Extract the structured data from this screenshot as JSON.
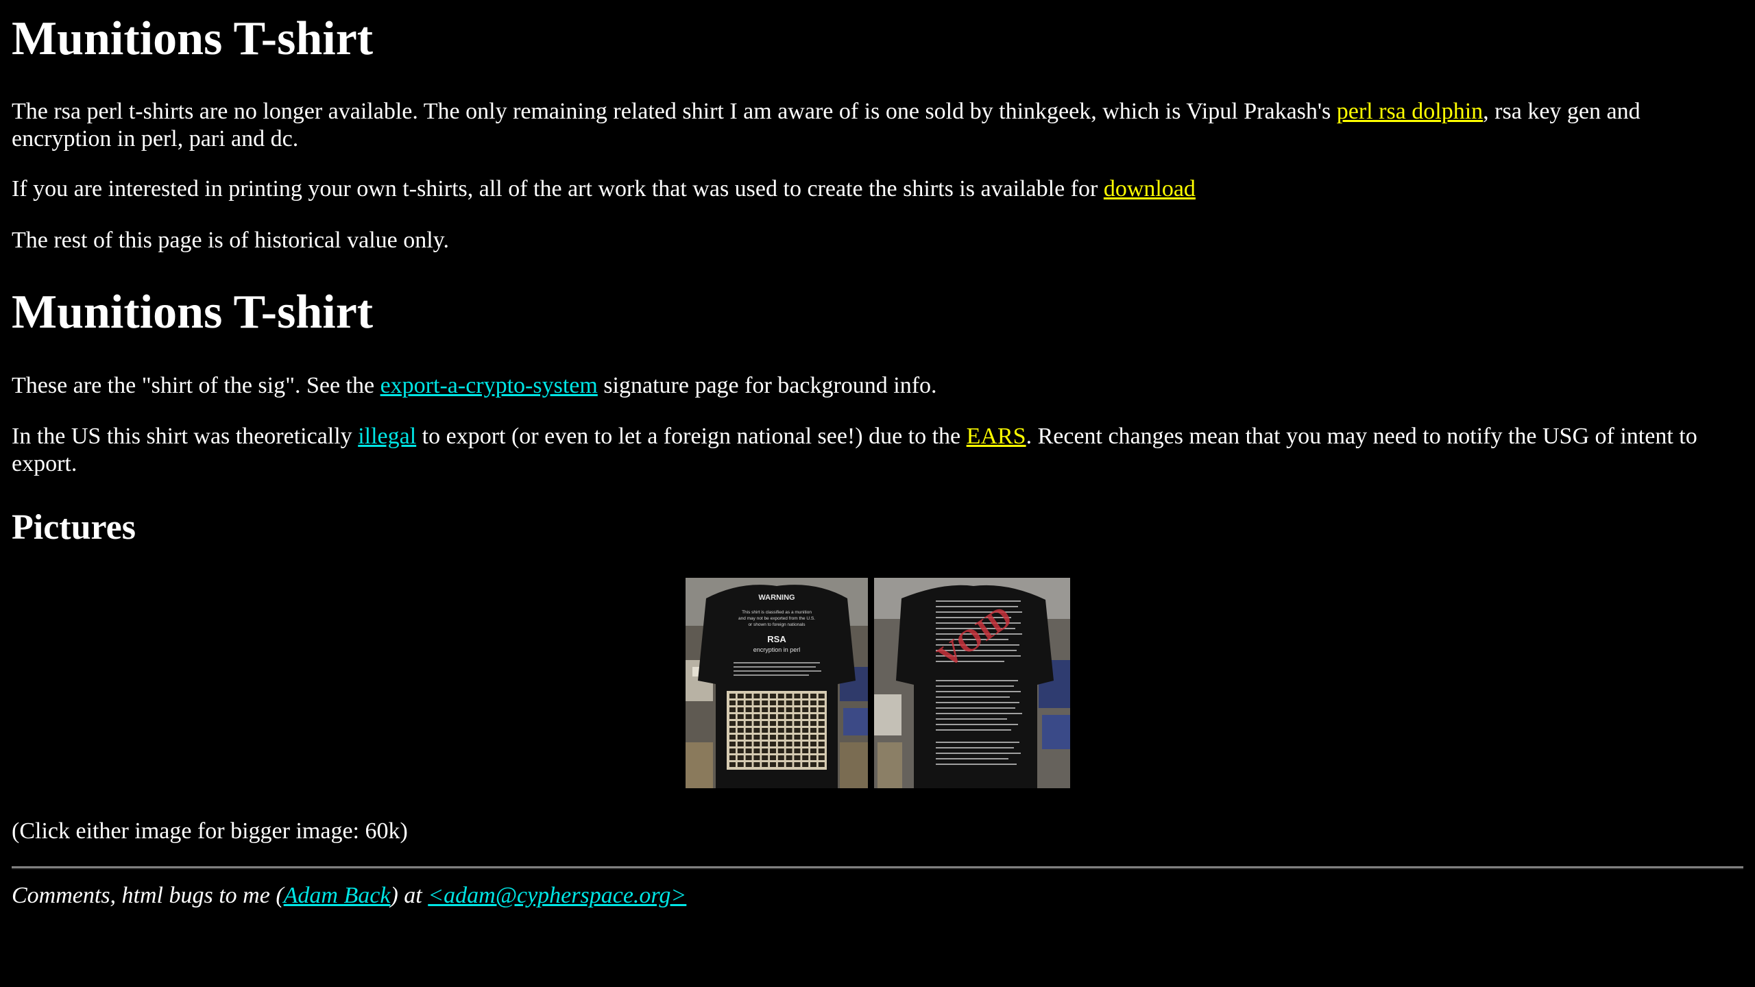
{
  "colors": {
    "background": "#000000",
    "text": "#ffffff",
    "link_visited": "#ffff00",
    "link": "#00e5e5"
  },
  "section1": {
    "title": "Munitions T-shirt",
    "p1_before": "The rsa perl t-shirts are no longer available. The only remaining related shirt I am aware of is one sold by thinkgeek, which is Vipul Prakash's ",
    "p1_link": "perl rsa dolphin",
    "p1_after": ", rsa key gen and encryption in perl, pari and dc.",
    "p2_before": "If you are interested in printing your own t-shirts, all of the art work that was used to create the shirts is available for ",
    "p2_link": "download",
    "p3": "The rest of this page is of historical value only."
  },
  "section2": {
    "title": "Munitions T-shirt",
    "p4_before": "These are the \"shirt of the sig\". See the ",
    "p4_link": "export-a-crypto-system",
    "p4_after": " signature page for background info.",
    "p5_before": "In the US this shirt was theoretically ",
    "p5_link1": "illegal",
    "p5_mid": " to export (or even to let a foreign national see!) due to the ",
    "p5_link2": "EARS",
    "p5_after": ". Recent changes mean that you may need to notify the USG of intent to export."
  },
  "pictures": {
    "title": "Pictures",
    "front_shirt_text": {
      "heading": "WARNING",
      "lines": [
        "This shirt is classified as a munition",
        "and may not be exported from the U.S.",
        "or shown to foreign nationals"
      ],
      "brand": "RSA",
      "subtitle": "encryption in perl"
    },
    "back_shirt_stamp": "VOID",
    "caption": "(Click either image for bigger image: 60k)"
  },
  "footer": {
    "before": "Comments, html bugs to me (",
    "name_link": "Adam Back",
    "middle": ") at ",
    "email_link": "<adam@cypherspace.org>"
  }
}
